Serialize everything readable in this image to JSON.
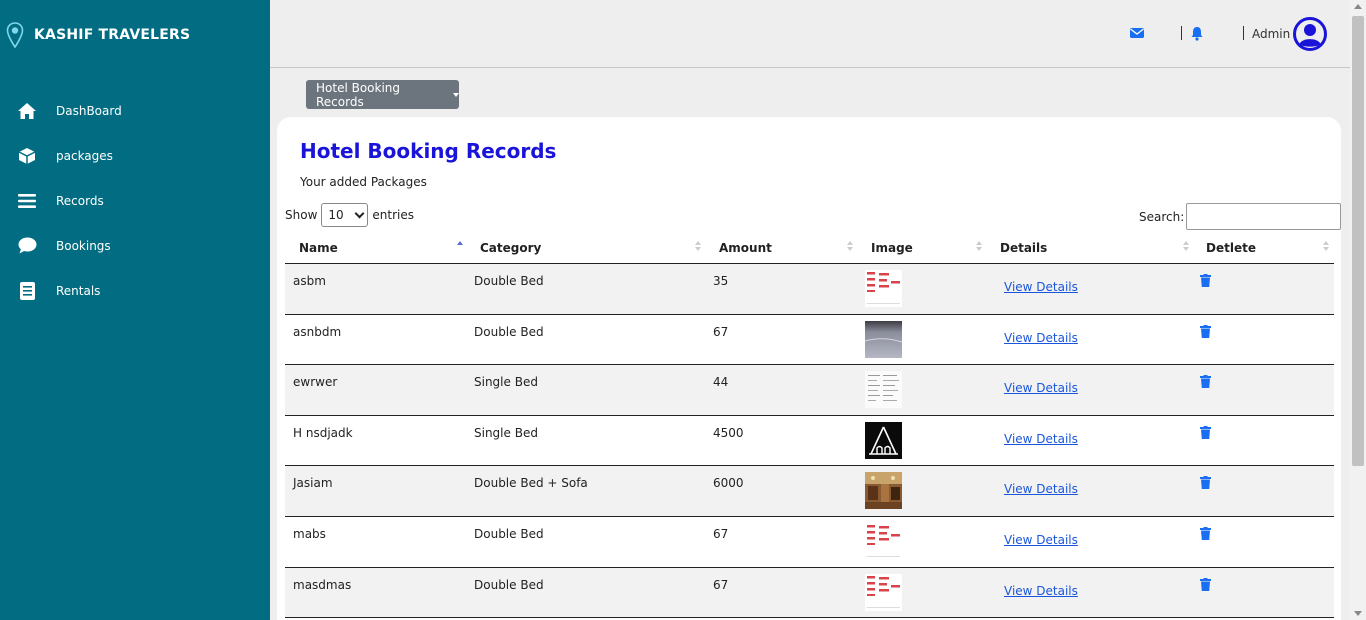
{
  "brand": {
    "name": "KASHIF TRAVELERS",
    "icon": "location-pin-icon"
  },
  "sidebar": {
    "items": [
      {
        "label": "DashBoard",
        "icon": "home-icon"
      },
      {
        "label": "packages",
        "icon": "box-icon"
      },
      {
        "label": "Records",
        "icon": "menu-bars-icon"
      },
      {
        "label": "Bookings",
        "icon": "chat-bubble-icon"
      },
      {
        "label": "Rentals",
        "icon": "document-icon"
      }
    ]
  },
  "topbar": {
    "admin_label": "Admin",
    "icons": [
      "envelope-icon",
      "bell-icon",
      "user-circle-icon"
    ]
  },
  "dropdown": {
    "label": "Hotel Booking Records"
  },
  "card": {
    "title": "Hotel Booking Records",
    "subtitle": "Your added Packages",
    "show_label": "Show",
    "entries_value": "10",
    "entries_label": "entries",
    "search_label": "Search:",
    "search_value": ""
  },
  "table": {
    "columns": [
      "Name",
      "Category",
      "Amount",
      "Image",
      "Details",
      "Detlete"
    ],
    "rows": [
      {
        "name": "asbm",
        "category": "Double Bed",
        "amount": "35",
        "image": "doc",
        "details": "View Details"
      },
      {
        "name": "asnbdm",
        "category": "Double Bed",
        "amount": "67",
        "image": "gray",
        "details": "View Details"
      },
      {
        "name": "ewrwer",
        "category": "Single Bed",
        "amount": "44",
        "image": "sheet",
        "details": "View Details"
      },
      {
        "name": "H nsdjadk",
        "category": "Single Bed",
        "amount": "4500",
        "image": "tent",
        "details": "View Details"
      },
      {
        "name": "Jasiam",
        "category": "Double Bed + Sofa",
        "amount": "6000",
        "image": "photo",
        "details": "View Details"
      },
      {
        "name": "mabs",
        "category": "Double Bed",
        "amount": "67",
        "image": "doc",
        "details": "View Details"
      },
      {
        "name": "masdmas",
        "category": "Double Bed",
        "amount": "67",
        "image": "doc",
        "details": "View Details"
      }
    ]
  },
  "colors": {
    "sidebar": "#026d82",
    "title": "#1a14d9",
    "link": "#1a56db",
    "icon_blue": "#1a6ef2",
    "button_gray": "#6c757d"
  }
}
